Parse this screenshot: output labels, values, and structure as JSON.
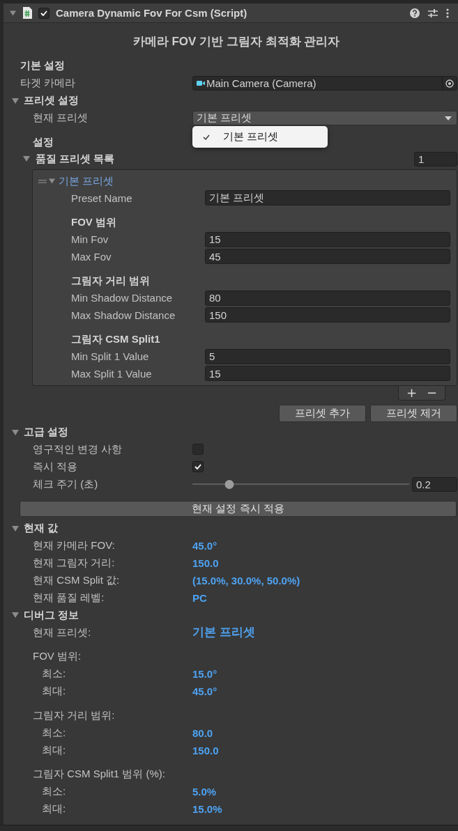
{
  "component": {
    "title": "Camera Dynamic Fov For Csm (Script)",
    "expanded": true,
    "enabled": true
  },
  "heading": "카메라 FOV 기반 그림자 최적화 관리자",
  "basic": {
    "title": "기본 설정",
    "target_camera": {
      "label": "타겟 카메라",
      "value": "Main Camera (Camera)"
    }
  },
  "presets": {
    "title": "프리셋 설정",
    "expanded": true,
    "current": {
      "label": "현재 프리셋",
      "value": "기본 프리셋"
    },
    "menu": [
      {
        "label": "기본 프리셋",
        "selected": true
      }
    ],
    "settings_title": "설정",
    "list": {
      "title": "품질 프리셋 목록",
      "expanded": true,
      "size": "1",
      "items": [
        {
          "title": "기본 프리셋",
          "expanded": true,
          "rows": [
            {
              "kind": "field",
              "label": "Preset Name",
              "value": "기본 프리셋"
            },
            {
              "kind": "header",
              "label": "FOV 범위"
            },
            {
              "kind": "field",
              "label": "Min Fov",
              "value": "15"
            },
            {
              "kind": "field",
              "label": "Max Fov",
              "value": "45"
            },
            {
              "kind": "header",
              "label": "그림자 거리 범위"
            },
            {
              "kind": "field",
              "label": "Min Shadow Distance",
              "value": "80"
            },
            {
              "kind": "field",
              "label": "Max Shadow Distance",
              "value": "150"
            },
            {
              "kind": "header",
              "label": "그림자 CSM Split1"
            },
            {
              "kind": "field",
              "label": "Min Split 1 Value",
              "value": "5"
            },
            {
              "kind": "field",
              "label": "Max Split 1 Value",
              "value": "15"
            }
          ]
        }
      ],
      "footer_buttons": [
        "+",
        "−"
      ]
    },
    "buttons": [
      "프리셋 추가",
      "프리셋 제거"
    ]
  },
  "advanced": {
    "title": "고급 설정",
    "expanded": true,
    "rows": [
      {
        "kind": "checkbox",
        "label": "영구적인 변경 사항",
        "checked": false
      },
      {
        "kind": "checkbox",
        "label": "즉시 적용",
        "checked": true
      },
      {
        "kind": "slider",
        "label": "체크 주기 (초)",
        "level": 0.17,
        "value": "0.2"
      }
    ],
    "apply_button": "현재 설정 즉시 적용"
  },
  "current_values": {
    "title": "현재 값",
    "expanded": true,
    "rows": [
      {
        "label": "현재 카메라 FOV:",
        "value": "45.0°"
      },
      {
        "label": "현재 그림자 거리:",
        "value": "150.0"
      },
      {
        "label": "현재 CSM Split 값:",
        "value": "(15.0%, 30.0%, 50.0%)"
      },
      {
        "label": "현재 품질 레벨:",
        "value": "PC"
      }
    ]
  },
  "debug": {
    "title": "디버그 정보",
    "expanded": true,
    "rows": [
      {
        "kind": "emphasis",
        "label": "현재 프리셋:",
        "value": "기본 프리셋"
      },
      {
        "kind": "group",
        "label": "FOV 범위:"
      },
      {
        "kind": "sub",
        "label": "최소:",
        "value": "15.0°"
      },
      {
        "kind": "sub",
        "label": "최대:",
        "value": "45.0°"
      },
      {
        "kind": "group",
        "label": "그림자 거리 범위:"
      },
      {
        "kind": "sub",
        "label": "최소:",
        "value": "80.0"
      },
      {
        "kind": "sub",
        "label": "최대:",
        "value": "150.0"
      },
      {
        "kind": "group",
        "label": "그림자 CSM Split1 범위 (%):"
      },
      {
        "kind": "sub",
        "label": "최소:",
        "value": "5.0%"
      },
      {
        "kind": "sub",
        "label": "최대:",
        "value": "15.0%"
      }
    ]
  }
}
